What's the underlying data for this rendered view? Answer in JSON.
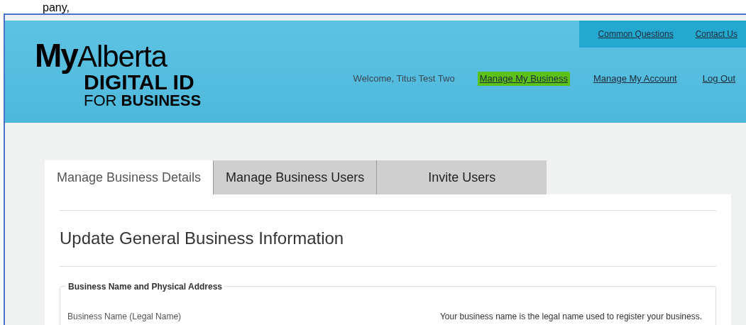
{
  "caption": "pany,",
  "logo": {
    "my": "My",
    "alberta": "Alberta",
    "digital_id": "DIGITAL ID",
    "for": "FOR",
    "business": "BUSINESS"
  },
  "utility_links": [
    "Common Questions",
    "Contact Us"
  ],
  "welcome": "Welcome, Titus Test Two",
  "nav_links": [
    {
      "label": "Manage My Business",
      "highlighted": true
    },
    {
      "label": "Manage My Account",
      "highlighted": false
    },
    {
      "label": "Log Out",
      "highlighted": false
    }
  ],
  "tabs": [
    {
      "label": "Manage Business Details",
      "selected": true
    },
    {
      "label": "Manage Business Users",
      "selected": false
    },
    {
      "label": "Invite Users",
      "selected": false
    }
  ],
  "heading": "Update General Business Information",
  "fieldset": {
    "legend": "Business Name and Physical Address",
    "field_label": "Business Name (Legal Name)",
    "help": "Your business name is the legal name used to register your business."
  }
}
